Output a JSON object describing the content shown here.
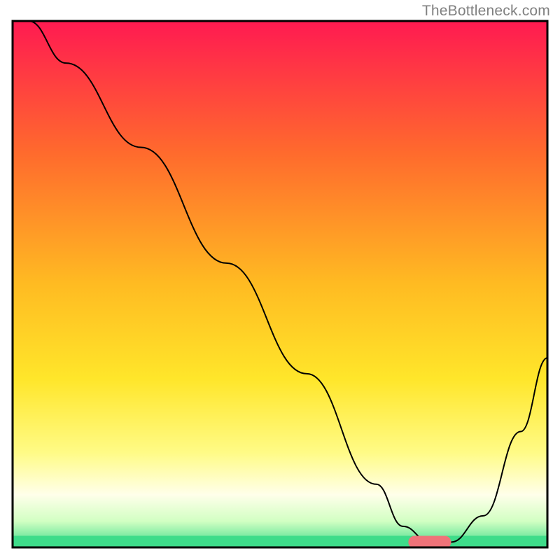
{
  "watermark": "TheBottleneck.com",
  "chart_data": {
    "type": "line",
    "title": "",
    "xlabel": "",
    "ylabel": "",
    "xlim": [
      0,
      100
    ],
    "ylim": [
      0,
      100
    ],
    "background_gradient_stops": [
      {
        "offset": 0,
        "color": "#ff1a51"
      },
      {
        "offset": 25,
        "color": "#ff6a2d"
      },
      {
        "offset": 50,
        "color": "#ffbb22"
      },
      {
        "offset": 68,
        "color": "#ffe62a"
      },
      {
        "offset": 82,
        "color": "#fffb86"
      },
      {
        "offset": 90,
        "color": "#ffffea"
      },
      {
        "offset": 95,
        "color": "#d2ffc3"
      },
      {
        "offset": 100,
        "color": "#3edc8a"
      }
    ],
    "series": [
      {
        "name": "bottleneck-curve",
        "color": "#000000",
        "stroke_width": 2,
        "x": [
          3,
          10,
          24,
          40,
          55,
          68,
          73,
          78,
          82,
          88,
          95,
          100
        ],
        "y": [
          100,
          92,
          76,
          54,
          33,
          12,
          4,
          1,
          1,
          6,
          22,
          36
        ]
      }
    ],
    "markers": [
      {
        "name": "highlight-capsule",
        "shape": "capsule",
        "color": "#ef7379",
        "x_center": 78,
        "y_center": 1,
        "width": 8,
        "height": 2.4
      }
    ],
    "bottom_band_color": "#3edc8a",
    "bottom_band_height_pct": 2.2
  }
}
